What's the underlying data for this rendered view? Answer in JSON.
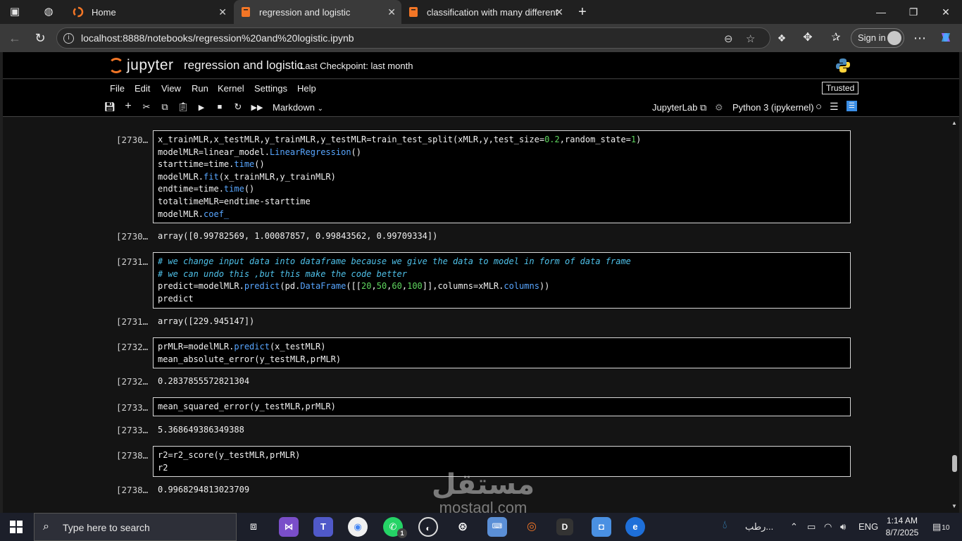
{
  "browser": {
    "tabs": [
      {
        "label": "Home",
        "active": false
      },
      {
        "label": "regression and logistic",
        "active": true
      },
      {
        "label": "classification with many different",
        "active": false
      }
    ],
    "url": "localhost:8888/notebooks/regression%20and%20logistic.ipynb",
    "sign_in": "Sign in"
  },
  "jupyter": {
    "logo": "jupyter",
    "notebook_name": "regression and logistic",
    "checkpoint": "Last Checkpoint: last month",
    "menu": [
      "File",
      "Edit",
      "View",
      "Run",
      "Kernel",
      "Settings",
      "Help"
    ],
    "trusted": "Trusted",
    "cell_type": "Markdown",
    "jupyterlab_link": "JupyterLab",
    "kernel": "Python 3 (ipykernel)"
  },
  "cells": [
    {
      "in_prompt": "[2730…",
      "code_html": [
        "x_trainMLR,x_testMLR,y_trainMLR,y_testMLR=train_test_split(xMLR,y,test_size=<span class=\"num\">0.2</span>,random_state=<span class=\"num\">1</span>)",
        "modelMLR=linear_model.<span class=\"kw\">LinearRegression</span>()",
        "starttime=time.<span class=\"kw\">time</span>()",
        "modelMLR.<span class=\"kw\">fit</span>(x_trainMLR,y_trainMLR)",
        "endtime=time.<span class=\"kw\">time</span>()",
        "totaltimeMLR=endtime-starttime",
        "modelMLR.<span class=\"kw\">coef_</span>"
      ],
      "out_prompt": "[2730…",
      "output": "array([0.99782569, 1.00087857, 0.99843562, 0.99709334])"
    },
    {
      "in_prompt": "[2731…",
      "code_html": [
        "<span class=\"cm\"># we change input data into dataframe because we give the data to model in form of data frame</span>",
        "<span class=\"cm\"># we can undo this ,but this make the code better</span>",
        "predict=modelMLR.<span class=\"kw\">predict</span>(pd.<span class=\"kw\">DataFrame</span>([[<span class=\"num\">20</span>,<span class=\"num\">50</span>,<span class=\"num\">60</span>,<span class=\"num\">100</span>]],columns=xMLR.<span class=\"kw\">columns</span>))",
        "predict"
      ],
      "out_prompt": "[2731…",
      "output": "array([229.945147])"
    },
    {
      "in_prompt": "[2732…",
      "code_html": [
        "prMLR=modelMLR.<span class=\"kw\">predict</span>(x_testMLR)",
        "mean_absolute_error(y_testMLR,prMLR)"
      ],
      "out_prompt": "[2732…",
      "output": "0.2837855572821304"
    },
    {
      "in_prompt": "[2733…",
      "code_html": [
        "mean_squared_error(y_testMLR,prMLR)"
      ],
      "out_prompt": "[2733…",
      "output": "5.368649386349388"
    },
    {
      "in_prompt": "[2738…",
      "code_html": [
        "r2=r2_score(y_testMLR,prMLR)",
        "r2"
      ],
      "out_prompt": "[2738…",
      "output": "0.9968294813023709"
    }
  ],
  "taskbar": {
    "search_placeholder": "Type here to search",
    "weather": "رطب...",
    "language": "ENG",
    "time": "1:14 AM",
    "date": "8/7/2025",
    "notifications": "10",
    "whatsapp_badge": "1"
  },
  "watermark": {
    "text_ar": "مستقل",
    "text_en": "mostaql.com"
  }
}
